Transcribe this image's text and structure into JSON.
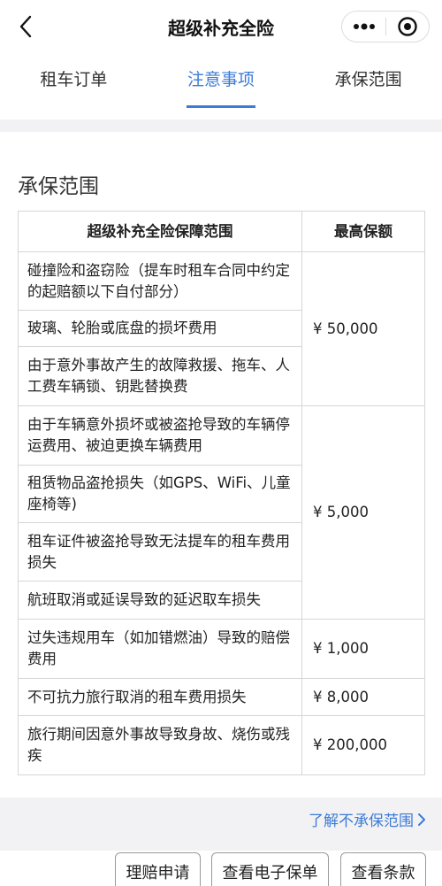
{
  "nav": {
    "title": "超级补充全险",
    "back_icon": "chevron-left-icon",
    "more_icon": "more-dots-icon",
    "close_icon": "target-close-icon"
  },
  "tabs": [
    {
      "label": "租车订单",
      "active": false
    },
    {
      "label": "注意事项",
      "active": true
    },
    {
      "label": "承保范围",
      "active": false
    }
  ],
  "section": {
    "title": "承保范围"
  },
  "table": {
    "headers": [
      "超级补充全险保障范围",
      "最高保额"
    ],
    "groups": [
      {
        "amount": "¥ 50,000",
        "items": [
          "碰撞险和盗窃险（提车时租车合同中约定的起赔额以下自付部分）",
          "玻璃、轮胎或底盘的损坏费用",
          "由于意外事故产生的故障救援、拖车、人工费车辆锁、钥匙替换费"
        ]
      },
      {
        "amount": "¥ 5,000",
        "items": [
          "由于车辆意外损坏或被盗抢导致的车辆停运费用、被迫更换车辆费用",
          "租赁物品盗抢损失（如GPS、WiFi、儿童座椅等)",
          "租车证件被盗抢导致无法提车的租车费用损失",
          "航班取消或延误导致的延迟取车损失"
        ]
      },
      {
        "amount": "¥ 1,000",
        "items": [
          "过失违规用车（如加错燃油）导致的赔偿费用"
        ]
      },
      {
        "amount": "¥ 8,000",
        "items": [
          "不可抗力旅行取消的租车费用损失"
        ]
      },
      {
        "amount": "¥ 200,000",
        "items": [
          "旅行期间因意外事故导致身故、烧伤或残疾"
        ]
      }
    ]
  },
  "footer": {
    "learn_more": "了解不承保范围"
  },
  "buttons": {
    "claim": "理赔申请",
    "view_policy": "查看电子保单",
    "view_terms": "查看条款"
  },
  "colors": {
    "accent": "#3c7bd6",
    "band": "#f2f2f4",
    "border": "#d6d6d6"
  }
}
